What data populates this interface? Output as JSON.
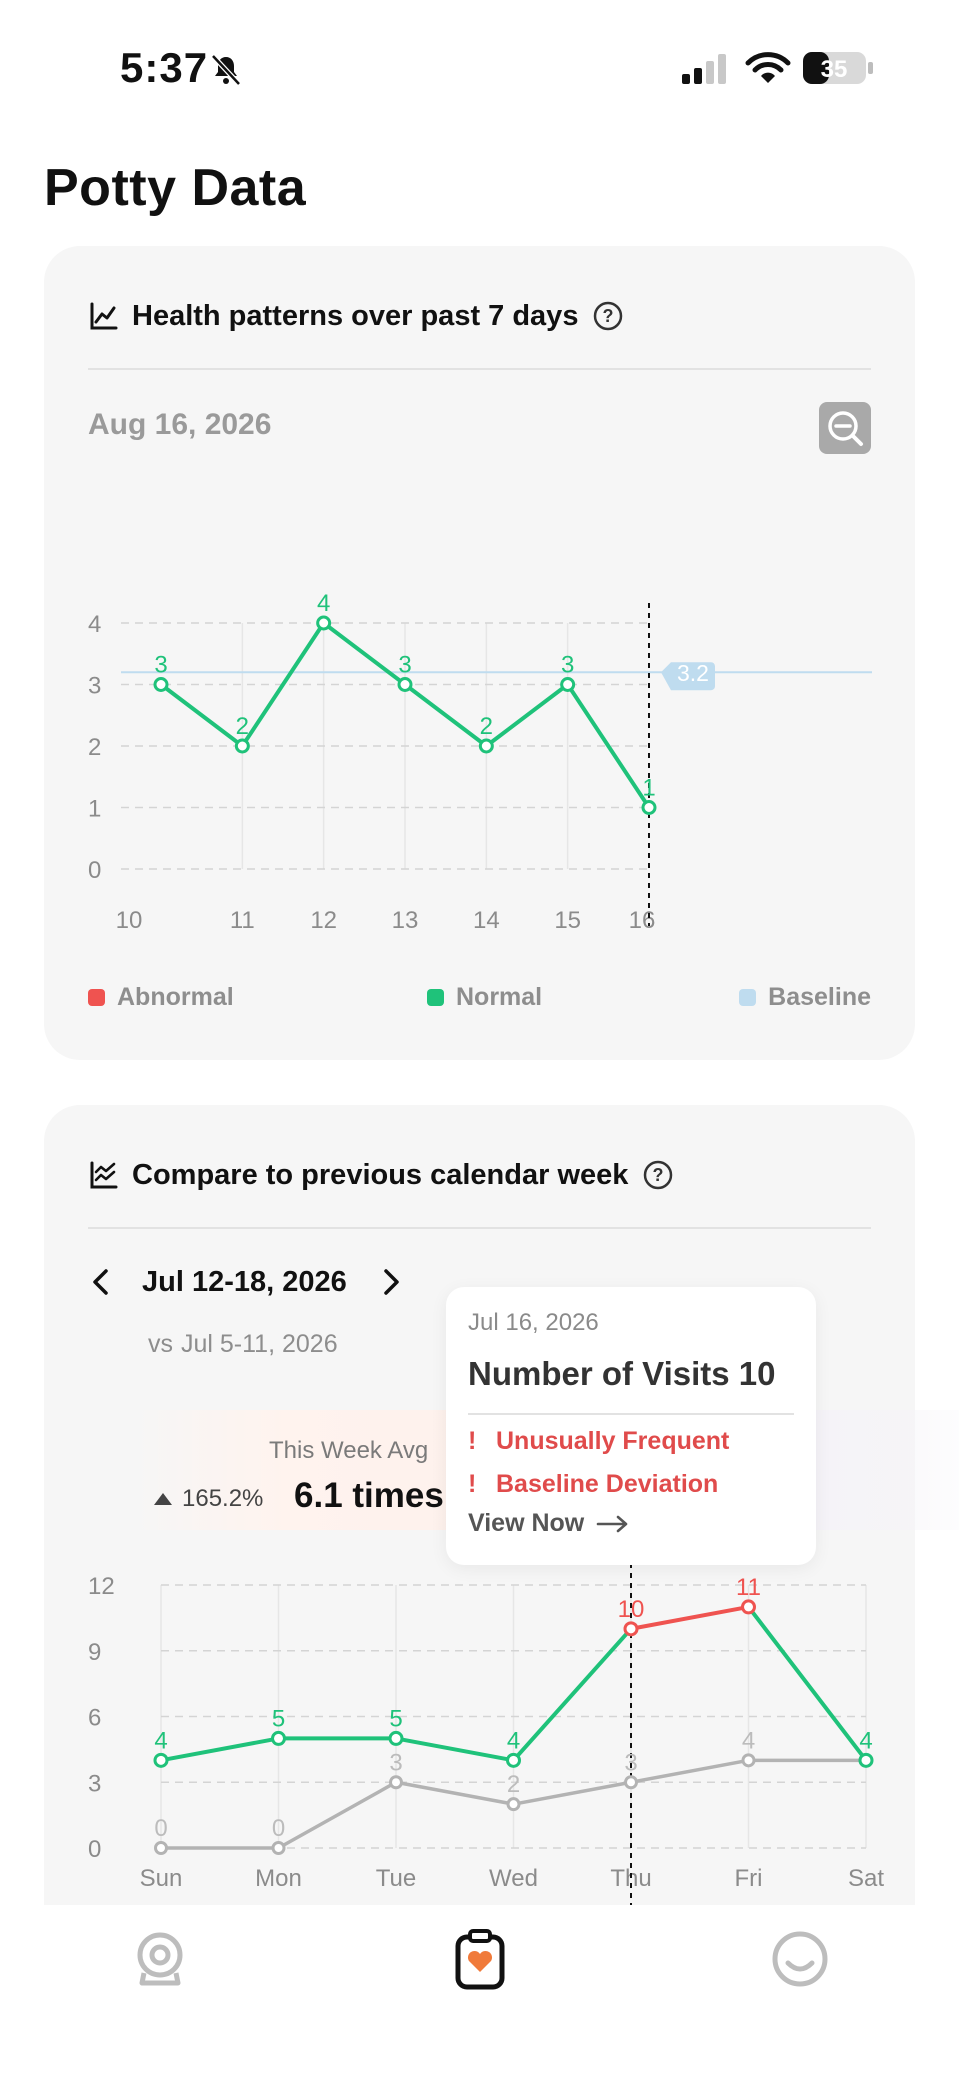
{
  "status_bar": {
    "time": "5:37",
    "battery": "35",
    "icons": [
      "bell-muted-icon",
      "cellular-signal-icon",
      "wifi-icon",
      "battery-icon"
    ]
  },
  "page": {
    "title": "Potty Data"
  },
  "health_card": {
    "title": "Health patterns over past 7 days",
    "date": "Aug 16, 2026",
    "icons": [
      "line-chart-icon",
      "help-icon",
      "zoom-out-icon"
    ],
    "legend": [
      {
        "label": "Abnormal",
        "color": "#ef5350"
      },
      {
        "label": "Normal",
        "color": "#1fc27a"
      },
      {
        "label": "Baseline",
        "color": "#bfdcef"
      }
    ]
  },
  "compare_card": {
    "title": "Compare to previous calendar week",
    "current_range": "Jul 12-18, 2026",
    "vs_prefix": "vs",
    "previous_range": "Jul 5-11, 2026",
    "avg_label": "This Week Avg",
    "avg_delta": "165.2%",
    "avg_value": "6.1 times",
    "icons": [
      "compare-chart-icon",
      "help-icon",
      "chevron-left-icon",
      "chevron-right-icon"
    ]
  },
  "tooltip": {
    "date": "Jul 16, 2026",
    "visits": "Number of Visits 10",
    "alerts": [
      "Unusually Frequent",
      "Baseline Deviation"
    ],
    "action": "View Now"
  },
  "tab_bar": {
    "tabs": [
      {
        "icon": "camera-icon",
        "active": false
      },
      {
        "icon": "health-clipboard-icon",
        "active": true
      },
      {
        "icon": "profile-face-icon",
        "active": false
      }
    ]
  },
  "chart_data": [
    {
      "type": "line",
      "x": [
        "10",
        "11",
        "12",
        "13",
        "14",
        "15",
        "16"
      ],
      "series": [
        {
          "status": "Normal",
          "values": [
            3,
            2,
            4,
            3,
            2,
            3,
            1
          ]
        }
      ],
      "baseline": 3.2,
      "baseline_label": "3.2",
      "ylim": [
        0,
        4
      ],
      "yticks": [
        "0",
        "1",
        "2",
        "3",
        "4"
      ],
      "highlight_x": "16",
      "grid": true
    },
    {
      "type": "line",
      "x": [
        "Sun",
        "Mon",
        "Tue",
        "Wed",
        "Thu",
        "Fri",
        "Sat"
      ],
      "series": [
        {
          "week": "current",
          "values": [
            4,
            5,
            5,
            4,
            10,
            11,
            4
          ],
          "abnormal_from": 4,
          "abnormal_to": 5
        },
        {
          "week": "previous",
          "values": [
            0,
            0,
            3,
            2,
            3,
            4,
            4
          ],
          "labels_shown": [
            0,
            0,
            3,
            2,
            3,
            4,
            null
          ]
        }
      ],
      "ylim": [
        0,
        12
      ],
      "yticks": [
        "0",
        "3",
        "6",
        "9",
        "12"
      ],
      "highlight_x": "Thu",
      "grid": true
    }
  ]
}
